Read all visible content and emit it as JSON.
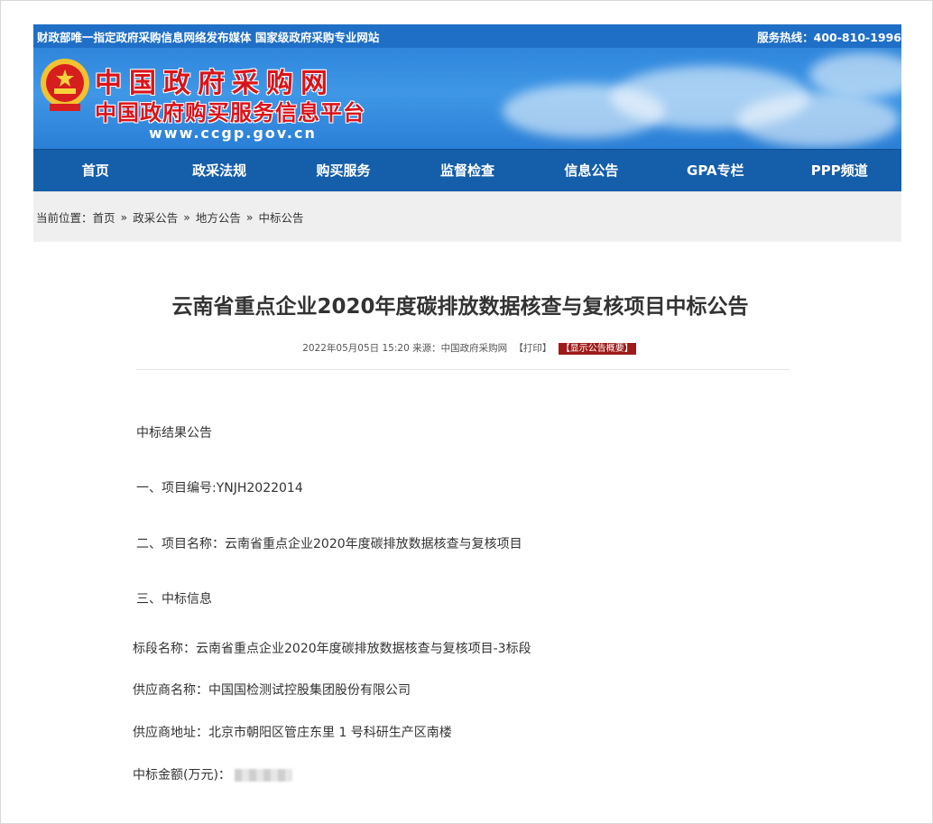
{
  "topbar": {
    "left_text": "财政部唯一指定政府采购信息网络发布媒体 国家级政府采购专业网站",
    "hotline": "服务热线：400-810-1996"
  },
  "banner": {
    "title_line1": "中国政府采购网",
    "title_line2": "中国政府购买服务信息平台",
    "url": "www.ccgp.gov.cn"
  },
  "nav": {
    "items": [
      "首页",
      "政采法规",
      "购买服务",
      "监督检查",
      "信息公告",
      "GPA专栏",
      "PPP频道"
    ]
  },
  "breadcrumb": {
    "prefix": "当前位置：",
    "items": [
      "首页",
      "政采公告",
      "地方公告",
      "中标公告"
    ],
    "separator": "»"
  },
  "article": {
    "title": "云南省重点企业2020年度碳排放数据核查与复核项目中标公告",
    "meta_datetime": "2022年05月05日 15:20",
    "meta_source": "来源：中国政府采购网",
    "print_label": "【打印】",
    "summary_badge": "【显示公告概要】",
    "paragraphs": {
      "p1": "中标结果公告",
      "p2": "一、项目编号:YNJH2022014",
      "p3": "二、项目名称：云南省重点企业2020年度碳排放数据核查与复核项目",
      "p4": "三、中标信息",
      "p5": "标段名称：云南省重点企业2020年度碳排放数据核查与复核项目-3标段",
      "p6": "供应商名称：中国国检测试控股集团股份有限公司",
      "p7": "供应商地址：北京市朝阳区管庄东里 1 号科研生产区南楼",
      "p8": "中标金额(万元)："
    }
  },
  "colors": {
    "topbar": "#1f6fc7",
    "nav": "#155ea9",
    "brand_red": "#d9141b",
    "badge": "#9e1b1b"
  }
}
